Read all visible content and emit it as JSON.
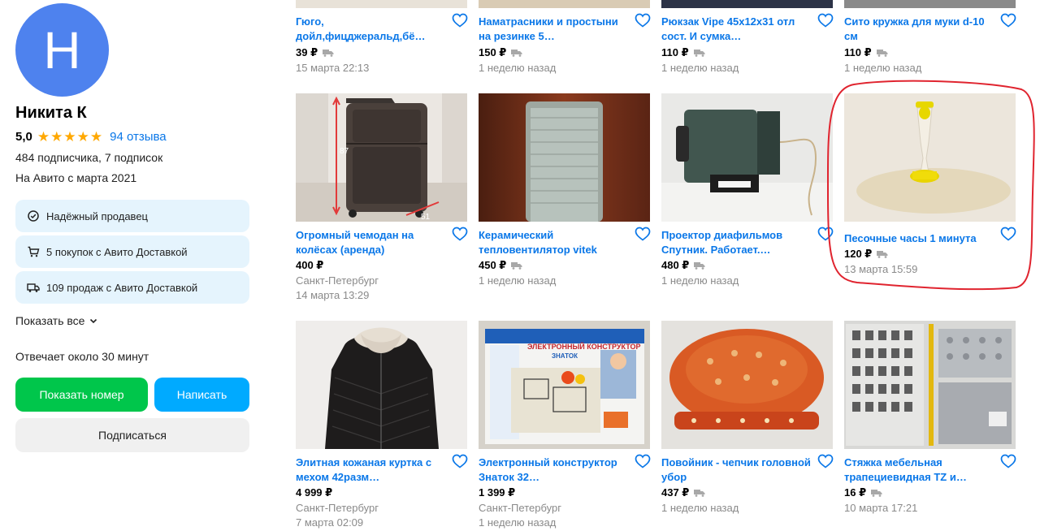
{
  "seller": {
    "avatar_letter": "Н",
    "name": "Никита К",
    "rating": "5,0",
    "stars": 5,
    "reviews": "94 отзыва",
    "subscribers": "484 подписчика, 7 подписок",
    "since": "На Авито с марта 2021",
    "badges": [
      {
        "label": "Надёжный продавец",
        "icon": "check-circle-icon"
      },
      {
        "label": "5 покупок с Авито Доставкой",
        "icon": "cart-icon"
      },
      {
        "label": "109 продаж с Авито Доставкой",
        "icon": "truck-icon"
      }
    ],
    "show_all": "Показать все",
    "responds": "Отвечает около 30 минут",
    "btn_phone": "Показать номер",
    "btn_write": "Написать",
    "btn_subscribe": "Подписаться"
  },
  "colors": {
    "accent": "#0a77e8",
    "green": "#00c64b",
    "blue": "#00aaff",
    "avatar": "#4e82ee",
    "badge_bg": "#e5f4fd",
    "star": "#ffa800",
    "highlight": "#e0242f"
  },
  "listings": [
    {
      "title": "Гюго, дойл,фицджеральд,бё…",
      "price": "39 ₽",
      "location": "",
      "date": "15 марта 22:13"
    },
    {
      "title": "Наматрасники и простыни на резинке 5…",
      "price": "150 ₽",
      "location": "",
      "date": "1 неделю назад"
    },
    {
      "title": "Рюкзак Vipe 45x12x31 отл сост. И сумка…",
      "price": "110 ₽",
      "location": "",
      "date": "1 неделю назад"
    },
    {
      "title": "Сито кружка для муки d-10 см",
      "price": "110 ₽",
      "location": "",
      "date": "1 неделю назад"
    },
    {
      "title": "Огромный чемодан на колёсах (аренда)",
      "price": "400 ₽",
      "location": "Санкт-Петербург",
      "date": "14 марта 13:29",
      "image": "suitcase",
      "image_labels": [
        "87",
        "51"
      ]
    },
    {
      "title": "Керамический тепловентилятор vitek",
      "price": "450 ₽",
      "location": "",
      "date": "1 неделю назад",
      "image": "heater"
    },
    {
      "title": "Проектор диафильмов Спутник. Работает.…",
      "price": "480 ₽",
      "location": "",
      "date": "1 неделю назад",
      "image": "projector"
    },
    {
      "title": "Песочные часы 1 минута",
      "price": "120 ₽",
      "location": "",
      "date": "13 марта 15:59",
      "image": "hourglass",
      "highlighted": true
    },
    {
      "title": "Элитная кожаная куртка с мехом 42разм…",
      "price": "4 999 ₽",
      "location": "Санкт-Петербург",
      "date": "7 марта 02:09",
      "image": "jacket"
    },
    {
      "title": "Электронный конструктор Знаток 32…",
      "price": "1 399 ₽",
      "location": "Санкт-Петербург",
      "date": "1 неделю назад",
      "image": "kit",
      "image_labels": [
        "ЭЛЕКТРОННЫЙ КОНСТРУКТОР",
        "ЗНАТОК"
      ]
    },
    {
      "title": "Повойник - чепчик головной убор",
      "price": "437 ₽",
      "location": "",
      "date": "1 неделю назад",
      "image": "hat"
    },
    {
      "title": "Стяжка мебельная трапециевидная TZ и…",
      "price": "16 ₽",
      "location": "",
      "date": "10 марта 17:21",
      "image": "ties"
    }
  ]
}
